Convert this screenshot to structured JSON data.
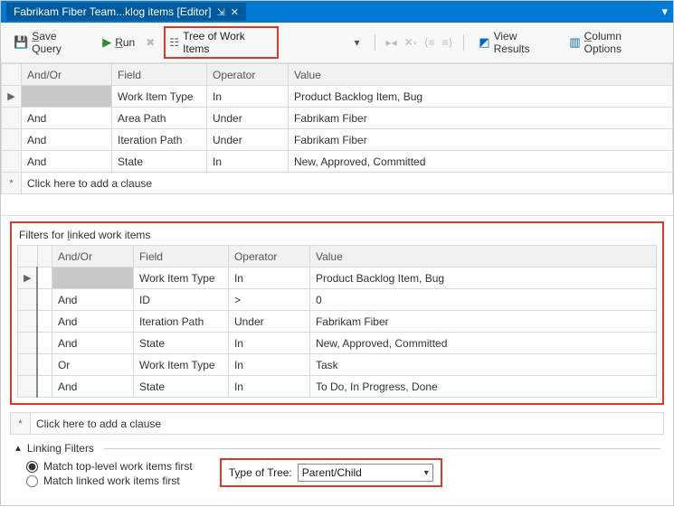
{
  "titlebar": {
    "tab_label": "Fabrikam Fiber Team...klog items [Editor]"
  },
  "toolbar": {
    "save_label": "Save Query",
    "run_label": "Run",
    "tree_label": "Tree of Work Items",
    "view_results_label": "View Results",
    "column_options_label": "Column Options"
  },
  "main_grid": {
    "headers": {
      "andor": "And/Or",
      "field": "Field",
      "operator": "Operator",
      "value": "Value"
    },
    "rows": [
      {
        "marker": "▶",
        "andor": "",
        "field": "Work Item Type",
        "operator": "In",
        "value": "Product Backlog Item, Bug",
        "active": true
      },
      {
        "marker": "",
        "andor": "And",
        "field": "Area Path",
        "operator": "Under",
        "value": "Fabrikam Fiber"
      },
      {
        "marker": "",
        "andor": "And",
        "field": "Iteration Path",
        "operator": "Under",
        "value": "Fabrikam Fiber"
      },
      {
        "marker": "",
        "andor": "And",
        "field": "State",
        "operator": "In",
        "value": "New, Approved, Committed"
      }
    ],
    "add_clause": "Click here to add a clause"
  },
  "linked": {
    "title_label": "Filters for linked work items",
    "headers": {
      "andor": "And/Or",
      "field": "Field",
      "operator": "Operator",
      "value": "Value"
    },
    "rows": [
      {
        "marker": "▶",
        "andor": "",
        "field": "Work Item Type",
        "operator": "In",
        "value": "Product Backlog Item, Bug",
        "active": true
      },
      {
        "marker": "",
        "andor": "And",
        "field": "ID",
        "operator": ">",
        "value": "0"
      },
      {
        "marker": "",
        "andor": "And",
        "field": "Iteration Path",
        "operator": "Under",
        "value": "Fabrikam Fiber"
      },
      {
        "marker": "",
        "andor": "And",
        "field": "State",
        "operator": "In",
        "value": "New, Approved, Committed"
      },
      {
        "marker": "",
        "andor": "Or",
        "field": "Work Item Type",
        "operator": "In",
        "value": "Task"
      },
      {
        "marker": "",
        "andor": "And",
        "field": "State",
        "operator": "In",
        "value": "To Do, In Progress, Done"
      }
    ],
    "add_clause": "Click here to add a clause"
  },
  "linking": {
    "header_label": "Linking Filters",
    "radio_top": "Match top-level work items first",
    "radio_linked": "Match linked work items first",
    "type_label": "Type of Tree:",
    "type_value": "Parent/Child"
  }
}
